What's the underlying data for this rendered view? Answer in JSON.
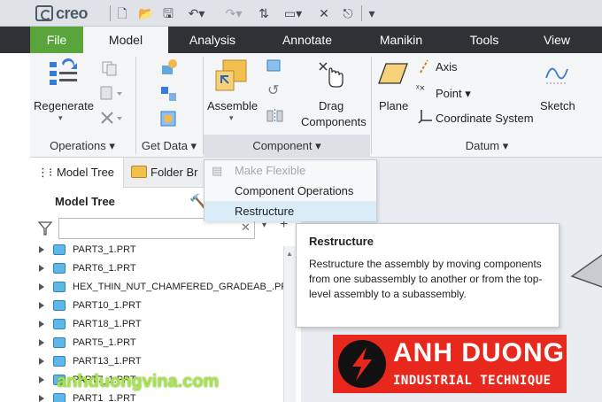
{
  "app": {
    "logo": "creo"
  },
  "ribbon_tabs": [
    "File",
    "Model",
    "Analysis",
    "Annotate",
    "Manikin",
    "Tools",
    "View"
  ],
  "ribbon": {
    "regenerate": "Regenerate",
    "assemble": "Assemble",
    "drag_components": [
      "Drag",
      "Components"
    ],
    "plane": "Plane",
    "axis": "Axis",
    "point": "Point",
    "coordinate_system": "Coordinate System",
    "sketch": "Sketch",
    "groups": {
      "operations": "Operations",
      "get_data": "Get Data",
      "component": "Component",
      "datum": "Datum"
    }
  },
  "panel": {
    "tabs": [
      "Model Tree",
      "Folder Br"
    ],
    "title": "Model Tree",
    "search_placeholder": "",
    "items": [
      "PART3_1.PRT",
      "PART6_1.PRT",
      "HEX_THIN_NUT_CHAMFERED_GRADEAB_.PRT",
      "PART10_1.PRT",
      "PART18_1.PRT",
      "PART5_1.PRT",
      "PART13_1.PRT",
      "PART7_1.PRT",
      "PART1_1.PRT"
    ]
  },
  "menu": {
    "items": [
      "Make Flexible",
      "Component Operations",
      "Restructure"
    ]
  },
  "tooltip": {
    "title": "Restructure",
    "body": "Restructure the assembly by moving components from one subassembly to another or from the top-level assembly to a subassembly."
  },
  "brand": {
    "name": "ANH DUONG",
    "tagline": "INDUSTRIAL TECHNIQUE",
    "site": "anhduongvina.com"
  },
  "colors": {
    "file_tab": "#5aa43c",
    "tab_bar": "#2f3135",
    "menu_hover": "#d9ecf8",
    "brand_red": "#e8281c"
  }
}
